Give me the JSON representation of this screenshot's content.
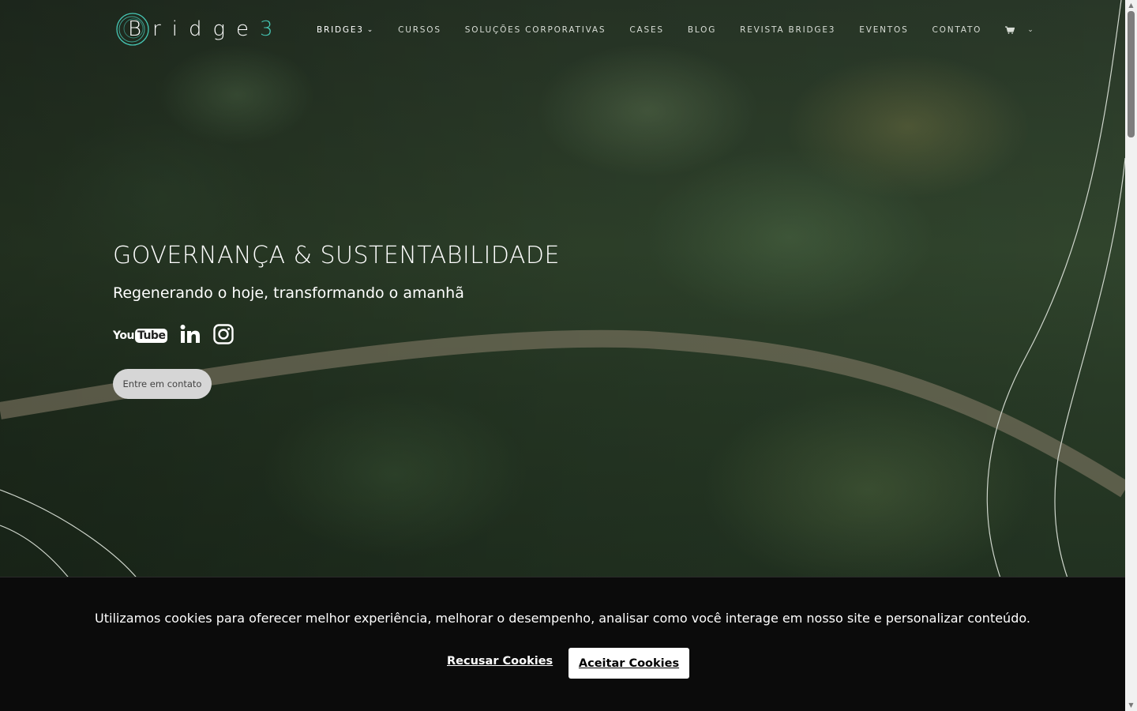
{
  "header": {
    "logo_text_main": "Bridge",
    "logo_text_accent": "3",
    "nav": [
      {
        "label": "BRIDGE3",
        "has_dropdown": true,
        "active": true
      },
      {
        "label": "CURSOS"
      },
      {
        "label": "SOLUÇÕES CORPORATIVAS"
      },
      {
        "label": "CASES"
      },
      {
        "label": "BLOG"
      },
      {
        "label": "REVISTA BRIDGE3"
      },
      {
        "label": "EVENTOS"
      },
      {
        "label": "CONTATO"
      }
    ],
    "cart_icon": "cart-icon"
  },
  "hero": {
    "title": "GOVERNANÇA & SUSTENTABILIDADE",
    "subtitle": "Regenerando o hoje, transformando o amanhã",
    "social": {
      "youtube_you": "You",
      "youtube_tube": "Tube"
    },
    "cta_label": "Entre em contato"
  },
  "cookie": {
    "message": "Utilizamos cookies para oferecer melhor experiência, melhorar o desempenho, analisar como você interage em nosso site e personalizar conteúdo.",
    "reject_label": "Recusar Cookies",
    "accept_label": "Aceitar Cookies"
  },
  "colors": {
    "accent": "#46c7b5",
    "cookie_bg": "#0b0b0b"
  }
}
